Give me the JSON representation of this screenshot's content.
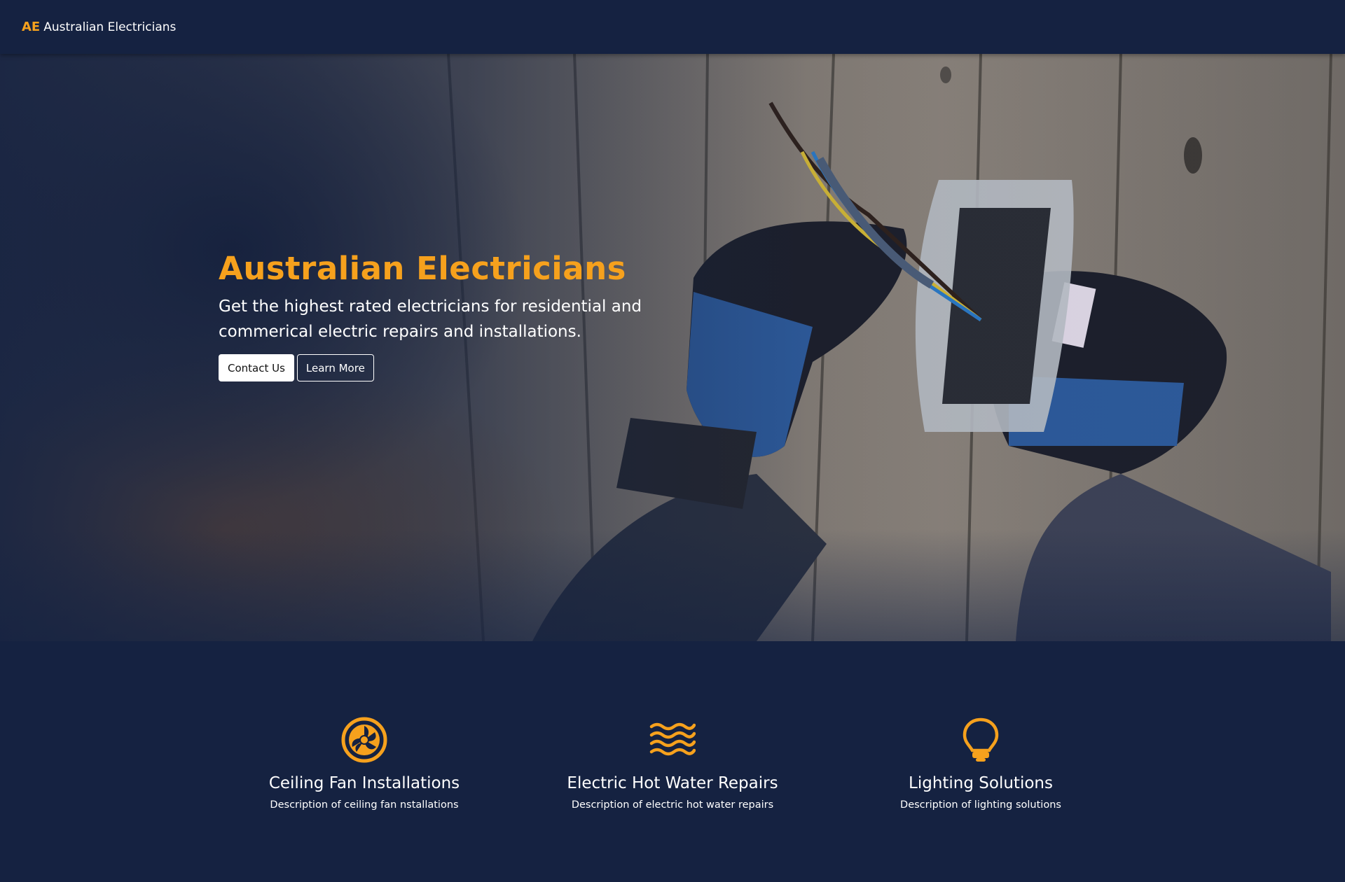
{
  "navbar": {
    "brand_mark": "AE",
    "brand_text": "Australian Electricians"
  },
  "hero": {
    "title": "Australian Electricians",
    "subtitle": "Get the highest rated electricians for residential and commerical electric repairs and installations.",
    "contact_label": "Contact Us",
    "learn_more_label": "Learn More",
    "image_description_icon": "electrician-hands-photo"
  },
  "services": [
    {
      "icon": "ceiling-fan-icon",
      "title": "Ceiling Fan Installations",
      "description": "Description of ceiling fan nstallations"
    },
    {
      "icon": "hot-water-waves-icon",
      "title": "Electric Hot Water Repairs",
      "description": "Description of electric hot water repairs"
    },
    {
      "icon": "lightbulb-icon",
      "title": "Lighting Solutions",
      "description": "Description of lighting solutions"
    }
  ],
  "colors": {
    "navy": "#152241",
    "accent": "#f6a11d",
    "text": "#ffffff"
  }
}
